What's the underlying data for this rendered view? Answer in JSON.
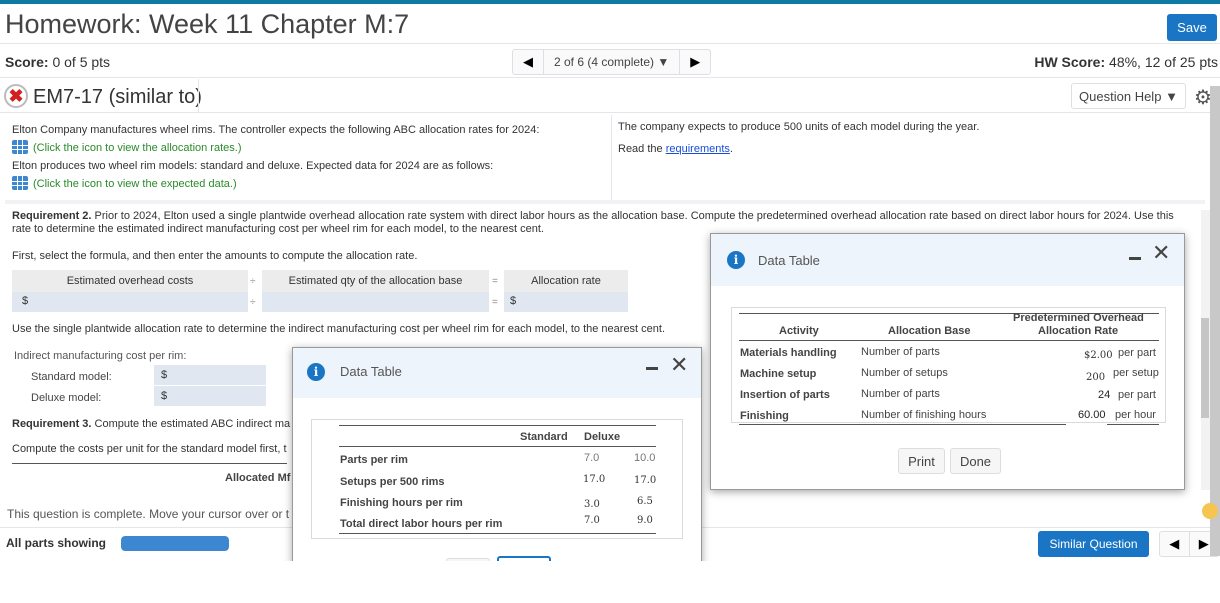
{
  "header": {
    "title": "Homework: Week 11 Chapter M:7",
    "save_label": "Save"
  },
  "score_row": {
    "score_label": "Score:",
    "score_value": "0 of 5 pts",
    "nav_text": "2 of 6 (4 complete)",
    "hw_score_label": "HW Score:",
    "hw_score_value": "48%, 12 of 25 pts"
  },
  "question": {
    "status_icon": "incorrect-x-icon",
    "title": "EM7-17 (similar to)",
    "help_label": "Question Help"
  },
  "info": {
    "line1": "Elton Company manufactures wheel rims. The controller expects the following ABC allocation rates for 2024:",
    "link1": "(Click the icon to view the allocation rates.)",
    "line2": "Elton produces two wheel rim models: standard and deluxe. Expected data for 2024 are as follows:",
    "link2": "(Click the icon to view the expected data.)",
    "right_line1": "The company expects to produce 500 units of each model during the year.",
    "read_prefix": "Read the ",
    "read_link": "requirements",
    "read_suffix": "."
  },
  "requirement2": {
    "label": "Requirement 2.",
    "text": " Prior to 2024, Elton used a single plantwide overhead allocation rate system with direct labor hours as the allocation base. Compute the predetermined overhead allocation rate based on direct labor hours for 2024. Use this rate to determine the estimated indirect manufacturing cost per wheel rim for each model, to the nearest cent.",
    "first_instruction": "First, select the formula, and then enter the amounts to compute the allocation rate.",
    "formula": {
      "col1": "Estimated overhead costs",
      "op1": "÷",
      "col2": "Estimated qty of the allocation base",
      "op2": "=",
      "col3": "Allocation rate",
      "currency": "$",
      "value1": "",
      "value2": "",
      "value3": ""
    },
    "use_instruction": "Use the single plantwide allocation rate to determine the indirect manufacturing cost per wheel rim for each model, to the nearest cent.",
    "indirect_label": "Indirect manufacturing cost per rim:",
    "standard_label": "Standard model:",
    "deluxe_label": "Deluxe model:",
    "standard_value": "",
    "deluxe_value": ""
  },
  "requirement3": {
    "label": "Requirement 3.",
    "text": " Compute the estimated ABC indirect ma",
    "compute_text": "Compute the costs per unit for the standard model first, t",
    "allocated_header": "Allocated Mf"
  },
  "footer": {
    "complete_text": "This question is complete. Move your cursor over or t",
    "all_parts_label": "All parts showing",
    "progress": 1.0,
    "similar_label": "Similar Question"
  },
  "dialog_expected": {
    "title": "Data Table",
    "columns": [
      "",
      "Standard",
      "Deluxe"
    ],
    "rows": [
      {
        "label": "Parts per rim",
        "standard": "7.0",
        "deluxe": "10.0"
      },
      {
        "label": "Setups per 500 rims",
        "standard": "17.0",
        "deluxe": "17.0"
      },
      {
        "label": "Finishing hours per rim",
        "standard": "3.0",
        "deluxe": "6.5"
      },
      {
        "label": "Total direct labor hours per rim",
        "standard": "7.0",
        "deluxe": "9.0"
      }
    ]
  },
  "dialog_rates": {
    "title": "Data Table",
    "col_activity": "Activity",
    "col_base": "Allocation Base",
    "col_rate_line1": "Predetermined Overhead",
    "col_rate_line2": "Allocation Rate",
    "rows": [
      {
        "activity": "Materials handling",
        "base": "Number of parts",
        "rate": "$2.00",
        "unit": "per part"
      },
      {
        "activity": "Machine setup",
        "base": "Number of setups",
        "rate": "200",
        "unit": "per setup"
      },
      {
        "activity": "Insertion of parts",
        "base": "Number of parts",
        "rate": "24",
        "unit": "per part"
      },
      {
        "activity": "Finishing",
        "base": "Number of finishing hours",
        "rate": "60.00",
        "unit": "per hour"
      }
    ],
    "print_label": "Print",
    "done_label": "Done"
  }
}
